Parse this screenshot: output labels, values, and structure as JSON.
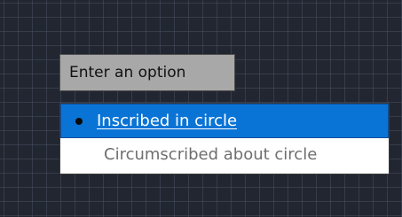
{
  "prompt": {
    "label": "Enter an option"
  },
  "options": [
    {
      "label": "Inscribed in circle",
      "selected": true
    },
    {
      "label": "Circumscribed about circle",
      "selected": false
    }
  ],
  "colors": {
    "canvas_background": "#222631",
    "prompt_background": "#a8a8a8",
    "selected_background": "#0a74d6",
    "unselected_text": "#6e6e6e"
  }
}
